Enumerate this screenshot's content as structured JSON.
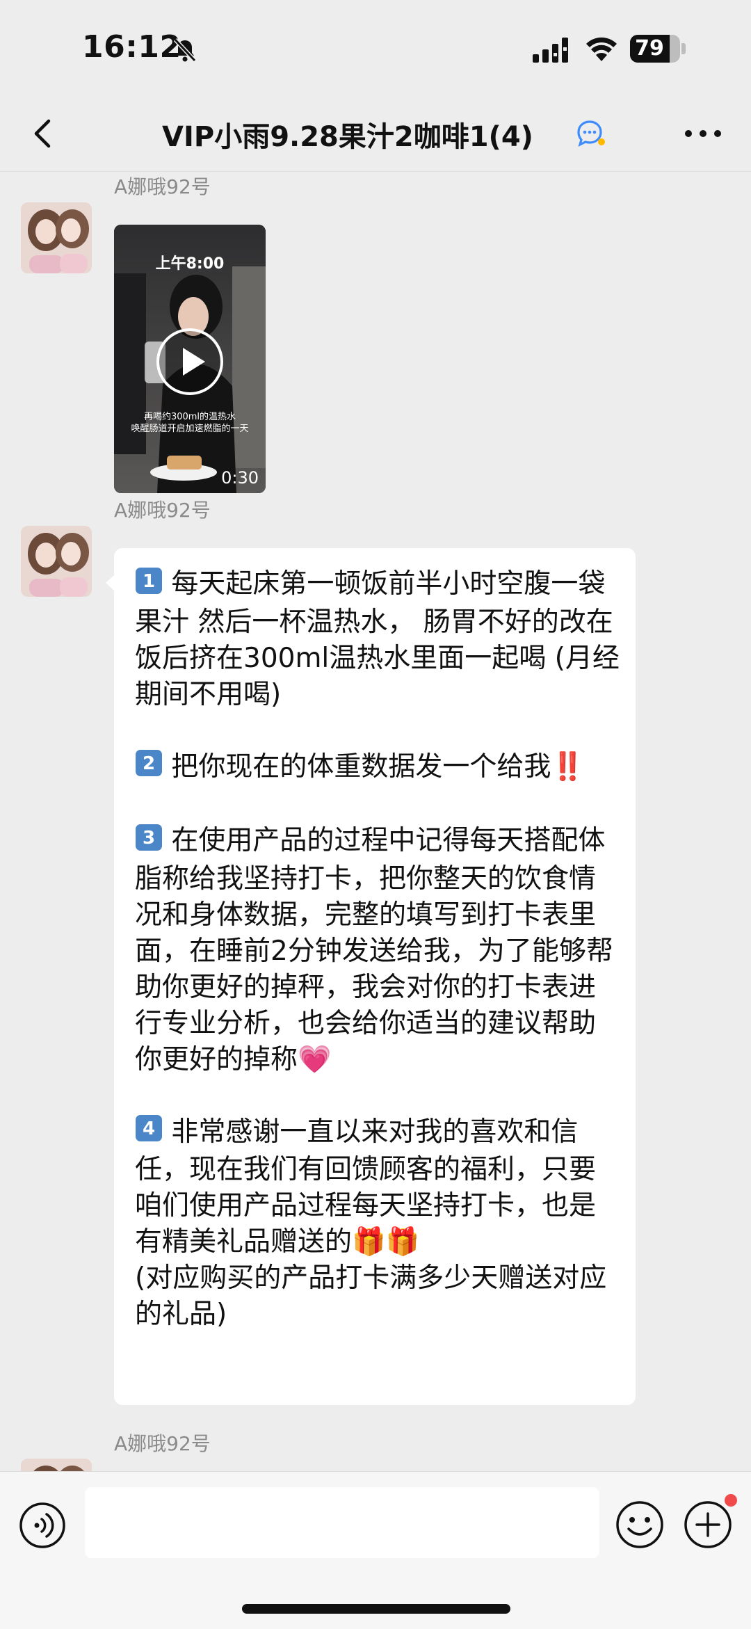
{
  "status_bar": {
    "time": "16:12",
    "battery_level": "79",
    "battery_fraction": 0.79,
    "icons": [
      "bell-off-icon",
      "signal-icon",
      "wifi-icon",
      "battery-icon"
    ]
  },
  "nav": {
    "back_icon": "chevron-left-icon",
    "title": "VIP小雨9.28果汁2咖啡1(4)",
    "title_badge_icon": "chat-bubbles-icon",
    "more_icon": "more-dots-icon"
  },
  "messages": [
    {
      "sender": "A娜哦92号",
      "type": "video",
      "overlay_time": "上午8:00",
      "caption_line1": "再喝约300ml的温热水",
      "caption_line2": "唤醒肠道开启加速燃脂的一天",
      "duration": "0:30"
    },
    {
      "sender": "A娜哦92号",
      "type": "text",
      "keycaps": [
        "1",
        "2",
        "3",
        "4"
      ],
      "item1": "每天起床第一顿饭前半小时空腹一袋果汁 然后一杯温热水， 肠胃不好的改在饭后挤在300ml温热水里面一起喝 (月经期间不用喝)",
      "item2": "把你现在的体重数据发一个给我",
      "item2_mark": "‼️",
      "item3": "在使用产品的过程中记得每天搭配体脂称给我坚持打卡，把你整天的饮食情况和身体数据，完整的填写到打卡表里面，在睡前2分钟发送给我，为了能够帮助你更好的掉秤，我会对你的打卡表进行专业分析，也会给你适当的建议帮助你更好的掉称",
      "item3_emoji": "💗",
      "item4": "非常感谢一直以来对我的喜欢和信任，现在我们有回馈顾客的福利，只要咱们使用产品过程每天坚持打卡，也是有精美礼品赠送的",
      "item4_emoji": "🎁🎁",
      "item4_note": "(对应购买的产品打卡满多少天赠送对应的礼品)"
    },
    {
      "sender": "A娜哦92号",
      "type": "partial"
    }
  ],
  "input_bar": {
    "voice_icon": "voice-icon",
    "emoji_icon": "smile-icon",
    "plus_icon": "plus-icon",
    "input_value": "",
    "placeholder": ""
  },
  "colors": {
    "background": "#ededed",
    "bubble": "#ffffff",
    "keycap": "#4a86c8",
    "notify_dot": "#f04a4a"
  }
}
